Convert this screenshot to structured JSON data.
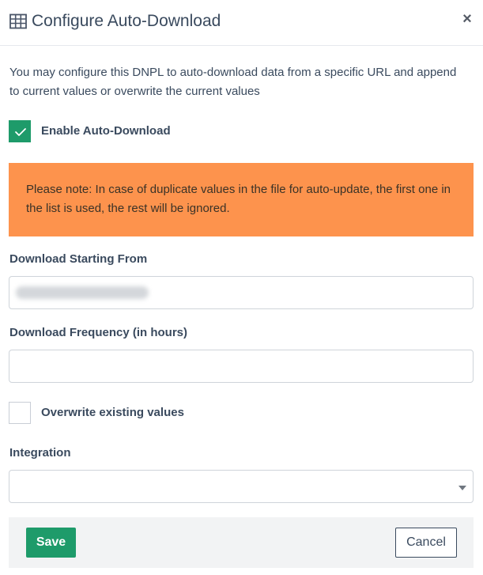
{
  "header": {
    "icon": "table-grid-icon",
    "title": "Configure Auto-Download",
    "close_label": "×"
  },
  "description": "You may configure this DNPL to auto-download data from a specific URL and append to current values or overwrite the current values",
  "enable_auto_download": {
    "label": "Enable Auto-Download",
    "checked": true
  },
  "notice": {
    "text": "Please note: In case of duplicate values in the file for auto-update, the first one in the list is used, the rest will be ignored.",
    "color": "#fd934d"
  },
  "download_starting_from": {
    "label": "Download Starting From",
    "value": "",
    "blurred": true
  },
  "download_frequency": {
    "label": "Download Frequency (in hours)",
    "value": ""
  },
  "overwrite_existing": {
    "label": "Overwrite existing values",
    "checked": false
  },
  "integration": {
    "label": "Integration",
    "selected": ""
  },
  "footer": {
    "save_label": "Save",
    "cancel_label": "Cancel"
  },
  "colors": {
    "accent": "#1e9b6a",
    "text": "#3a4a5e"
  }
}
